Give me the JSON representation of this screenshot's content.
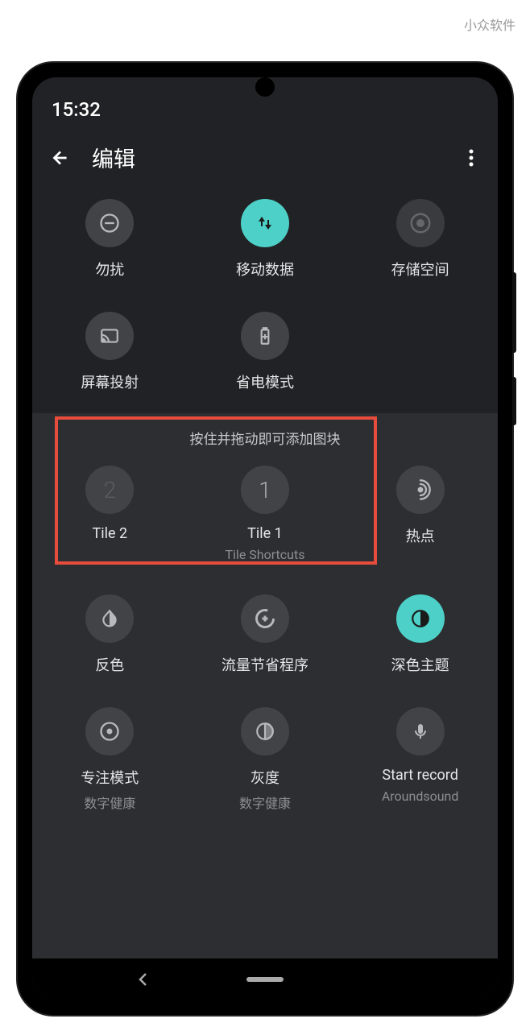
{
  "watermark": "小众软件",
  "status": {
    "time": "15:32"
  },
  "header": {
    "title": "编辑"
  },
  "upper_tiles": {
    "row1": [
      {
        "label": "勿扰",
        "icon": "dnd"
      },
      {
        "label": "移动数据",
        "icon": "data",
        "active": true
      },
      {
        "label": "存储空间",
        "icon": "storage"
      }
    ],
    "row2": [
      {
        "label": "屏幕投射",
        "icon": "cast"
      },
      {
        "label": "省电模式",
        "icon": "battery"
      }
    ]
  },
  "lower_section": {
    "hint": "按住并拖动即可添加图块",
    "row1": [
      {
        "label": "Tile 2",
        "number": "2",
        "dim": true
      },
      {
        "label": "Tile 1",
        "sublabel": "Tile Shortcuts",
        "number": "1"
      },
      {
        "label": "热点",
        "icon": "hotspot"
      }
    ],
    "row2": [
      {
        "label": "反色",
        "icon": "invert"
      },
      {
        "label": "流量节省程序",
        "icon": "datasaver"
      },
      {
        "label": "深色主题",
        "icon": "darktheme",
        "active": true
      }
    ],
    "row3": [
      {
        "label": "专注模式",
        "sublabel": "数字健康",
        "icon": "focus"
      },
      {
        "label": "灰度",
        "sublabel": "数字健康",
        "icon": "grayscale"
      },
      {
        "label": "Start record",
        "sublabel": "Aroundsound",
        "icon": "mic"
      }
    ]
  }
}
